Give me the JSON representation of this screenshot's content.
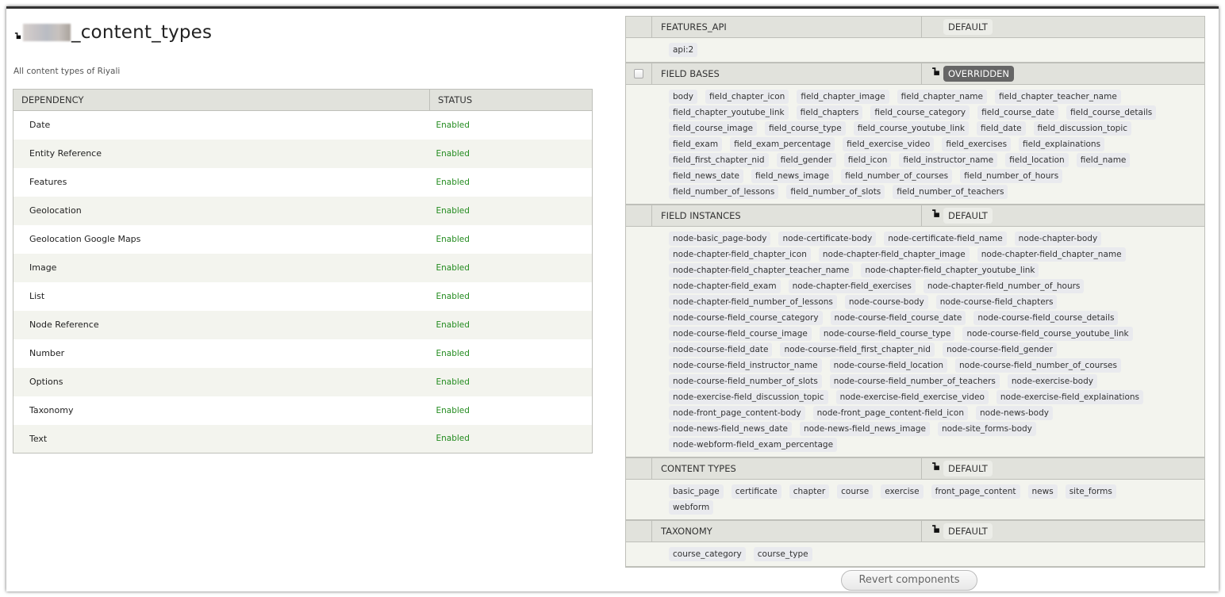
{
  "page": {
    "title_suffix": "_content_types",
    "title_redacted": true,
    "description": "All content types of Riyali"
  },
  "dependencies": {
    "headers": [
      "DEPENDENCY",
      "STATUS"
    ],
    "rows": [
      {
        "name": "Date",
        "status": "Enabled"
      },
      {
        "name": "Entity Reference",
        "status": "Enabled"
      },
      {
        "name": "Features",
        "status": "Enabled"
      },
      {
        "name": "Geolocation",
        "status": "Enabled"
      },
      {
        "name": "Geolocation Google Maps",
        "status": "Enabled"
      },
      {
        "name": "Image",
        "status": "Enabled"
      },
      {
        "name": "List",
        "status": "Enabled"
      },
      {
        "name": "Node Reference",
        "status": "Enabled"
      },
      {
        "name": "Number",
        "status": "Enabled"
      },
      {
        "name": "Options",
        "status": "Enabled"
      },
      {
        "name": "Taxonomy",
        "status": "Enabled"
      },
      {
        "name": "Text",
        "status": "Enabled"
      }
    ],
    "status_color": "#238b1f"
  },
  "components": [
    {
      "name": "FEATURES_API",
      "state": "DEFAULT",
      "has_checkbox": false,
      "has_lock": false,
      "items": [
        "api:2"
      ]
    },
    {
      "name": "FIELD BASES",
      "state": "OVERRIDDEN",
      "has_checkbox": true,
      "has_lock": true,
      "items": [
        "body",
        "field_chapter_icon",
        "field_chapter_image",
        "field_chapter_name",
        "field_chapter_teacher_name",
        "field_chapter_youtube_link",
        "field_chapters",
        "field_course_category",
        "field_course_date",
        "field_course_details",
        "field_course_image",
        "field_course_type",
        "field_course_youtube_link",
        "field_date",
        "field_discussion_topic",
        "field_exam",
        "field_exam_percentage",
        "field_exercise_video",
        "field_exercises",
        "field_explainations",
        "field_first_chapter_nid",
        "field_gender",
        "field_icon",
        "field_instructor_name",
        "field_location",
        "field_name",
        "field_news_date",
        "field_news_image",
        "field_number_of_courses",
        "field_number_of_hours",
        "field_number_of_lessons",
        "field_number_of_slots",
        "field_number_of_teachers"
      ]
    },
    {
      "name": "FIELD INSTANCES",
      "state": "DEFAULT",
      "has_checkbox": false,
      "has_lock": true,
      "items": [
        "node-basic_page-body",
        "node-certificate-body",
        "node-certificate-field_name",
        "node-chapter-body",
        "node-chapter-field_chapter_icon",
        "node-chapter-field_chapter_image",
        "node-chapter-field_chapter_name",
        "node-chapter-field_chapter_teacher_name",
        "node-chapter-field_chapter_youtube_link",
        "node-chapter-field_exam",
        "node-chapter-field_exercises",
        "node-chapter-field_number_of_hours",
        "node-chapter-field_number_of_lessons",
        "node-course-body",
        "node-course-field_chapters",
        "node-course-field_course_category",
        "node-course-field_course_date",
        "node-course-field_course_details",
        "node-course-field_course_image",
        "node-course-field_course_type",
        "node-course-field_course_youtube_link",
        "node-course-field_date",
        "node-course-field_first_chapter_nid",
        "node-course-field_gender",
        "node-course-field_instructor_name",
        "node-course-field_location",
        "node-course-field_number_of_courses",
        "node-course-field_number_of_slots",
        "node-course-field_number_of_teachers",
        "node-exercise-body",
        "node-exercise-field_discussion_topic",
        "node-exercise-field_exercise_video",
        "node-exercise-field_explainations",
        "node-front_page_content-body",
        "node-front_page_content-field_icon",
        "node-news-body",
        "node-news-field_news_date",
        "node-news-field_news_image",
        "node-site_forms-body",
        "node-webform-field_exam_percentage"
      ]
    },
    {
      "name": "CONTENT TYPES",
      "state": "DEFAULT",
      "has_checkbox": false,
      "has_lock": true,
      "items": [
        "basic_page",
        "certificate",
        "chapter",
        "course",
        "exercise",
        "front_page_content",
        "news",
        "site_forms",
        "webform"
      ]
    },
    {
      "name": "TAXONOMY",
      "state": "DEFAULT",
      "has_checkbox": false,
      "has_lock": true,
      "items": [
        "course_category",
        "course_type"
      ]
    }
  ],
  "actions": {
    "revert_label": "Revert components"
  }
}
